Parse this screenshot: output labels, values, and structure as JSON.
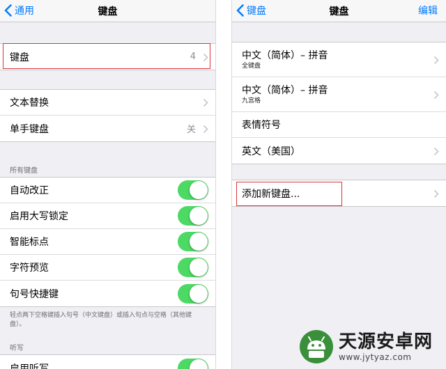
{
  "left": {
    "nav": {
      "back_label": "通用",
      "title": "键盘"
    },
    "group1": {
      "keyboards_label": "键盘",
      "keyboards_value": "4"
    },
    "group2": {
      "text_replacement_label": "文本替换",
      "one_handed_label": "单手键盘",
      "one_handed_value": "关"
    },
    "section_all_keyboards": "所有键盘",
    "toggles": [
      {
        "label": "自动改正",
        "on": true
      },
      {
        "label": "启用大写锁定",
        "on": true
      },
      {
        "label": "智能标点",
        "on": true
      },
      {
        "label": "字符预览",
        "on": true
      },
      {
        "label": "句号快捷键",
        "on": true
      }
    ],
    "footer_note": "轻点两下空格键插入句号（中文键盘）或插入句点与空格（其他键盘）。",
    "section_dictation": "听写",
    "dictation_label": "启用听写"
  },
  "right": {
    "nav": {
      "back_label": "键盘",
      "title": "键盘",
      "edit_label": "编辑"
    },
    "keyboards": [
      {
        "label": "中文（简体）– 拼音",
        "sub": "全键盘"
      },
      {
        "label": "中文（简体）– 拼音",
        "sub": "九宫格"
      },
      {
        "label": "表情符号"
      },
      {
        "label": "英文（美国）"
      }
    ],
    "add_keyboard_label": "添加新键盘..."
  },
  "watermark": {
    "text": "天源安卓网",
    "url": "www.jytyaz.com"
  },
  "colors": {
    "accent": "#007aff",
    "toggle_on": "#4cd964",
    "highlight": "#d9343a",
    "background": "#efeff4"
  }
}
